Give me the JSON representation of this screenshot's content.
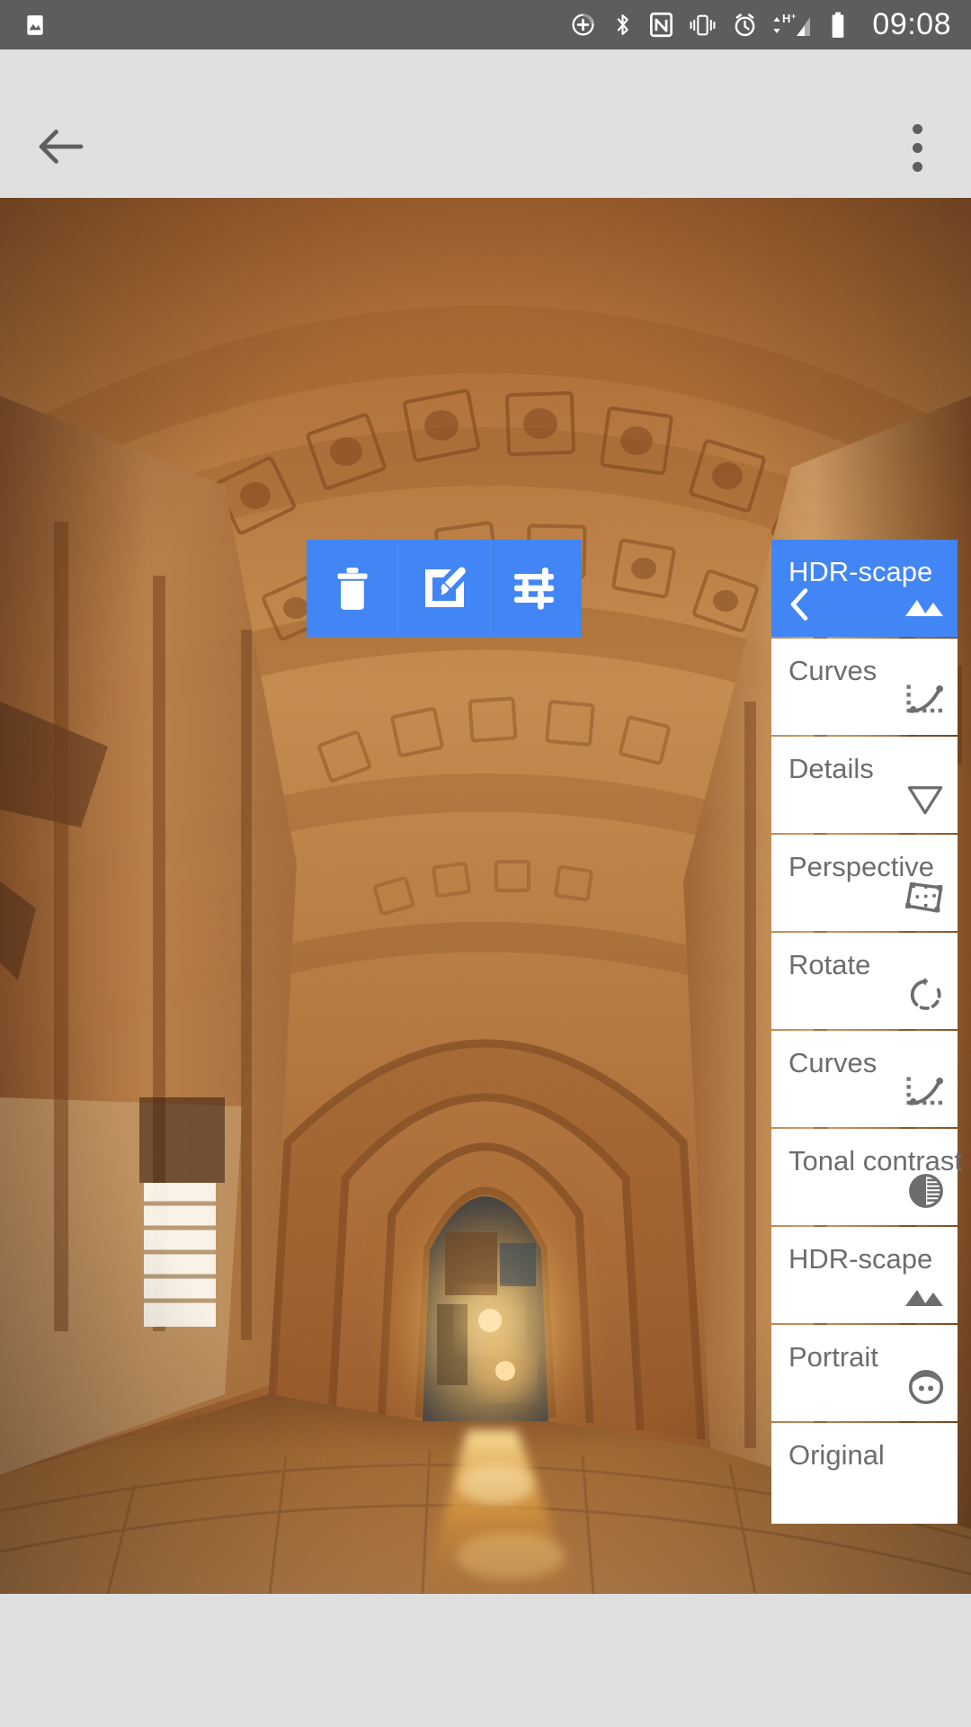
{
  "status_bar": {
    "time": "09:08",
    "left_icons": [
      {
        "name": "photo-notification-icon",
        "glyph": "image"
      }
    ],
    "right_icons": [
      {
        "name": "data-saver-icon",
        "glyph": "circle-plus"
      },
      {
        "name": "bluetooth-icon",
        "glyph": "bluetooth"
      },
      {
        "name": "nfc-icon",
        "glyph": "nfc"
      },
      {
        "name": "vibrate-icon",
        "glyph": "vibrate"
      },
      {
        "name": "alarm-icon",
        "glyph": "alarm"
      },
      {
        "name": "mobile-data-icon",
        "glyph": "hplus-signal"
      },
      {
        "name": "battery-icon",
        "glyph": "battery-full"
      }
    ],
    "background_color": "#5d5d5d",
    "foreground_color": "#ffffff"
  },
  "action_bar": {
    "back_label": "Back",
    "overflow_label": "More options",
    "background_color": "#e0e0e0"
  },
  "photo": {
    "alt": "Night view of an ornate stone arcade with coffered barrel vault ceiling receding toward a lit alley, warm amber HDR tones, wet cobblestone floor with golden reflections"
  },
  "image_toolbar": {
    "accent_color": "#4285f4",
    "buttons": [
      {
        "label": "Delete",
        "icon": "trash-icon"
      },
      {
        "label": "Edit",
        "icon": "brush-edit-icon"
      },
      {
        "label": "Tune",
        "icon": "tune-sliders-icon"
      }
    ]
  },
  "looks_panel": {
    "header": {
      "title": "HDR-scape",
      "back_icon": "chevron-left-icon",
      "icon": "mountains-icon",
      "selected": true,
      "background_color": "#4285f4",
      "text_color": "#ffffff"
    },
    "items": [
      {
        "title": "Curves",
        "icon": "curves-icon"
      },
      {
        "title": "Details",
        "icon": "details-triangle-icon"
      },
      {
        "title": "Perspective",
        "icon": "perspective-icon"
      },
      {
        "title": "Rotate",
        "icon": "rotate-icon"
      },
      {
        "title": "Curves",
        "icon": "curves-icon"
      },
      {
        "title": "Tonal contrast",
        "icon": "tonal-contrast-icon"
      },
      {
        "title": "HDR-scape",
        "icon": "mountains-icon"
      },
      {
        "title": "Portrait",
        "icon": "portrait-face-icon"
      },
      {
        "title": "Original",
        "icon": "none"
      }
    ],
    "item_background_color": "#ffffff",
    "item_text_color": "#6d6d6d"
  }
}
